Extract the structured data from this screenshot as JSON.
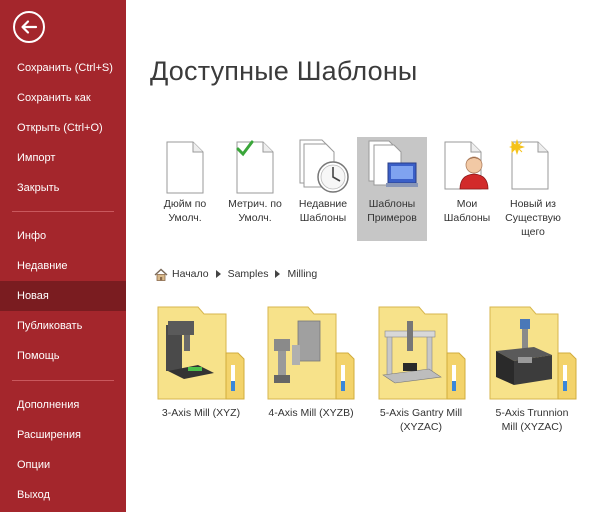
{
  "sidebar": {
    "back_label": "Назад",
    "items": [
      {
        "label": "Сохранить (Ctrl+S)"
      },
      {
        "label": "Сохранить как"
      },
      {
        "label": "Открыть (Ctrl+O)"
      },
      {
        "label": "Импорт"
      },
      {
        "label": "Закрыть"
      },
      {
        "label": "Инфо"
      },
      {
        "label": "Недавние"
      },
      {
        "label": "Новая",
        "active": true
      },
      {
        "label": "Публиковать"
      },
      {
        "label": "Помощь"
      },
      {
        "label": "Дополнения"
      },
      {
        "label": "Расширения"
      },
      {
        "label": "Опции"
      },
      {
        "label": "Выход"
      }
    ],
    "accent": "#a4262c",
    "active_color": "#7a1c20"
  },
  "main": {
    "title": "Доступные Шаблоны",
    "tiles": [
      {
        "line1": "Дюйм по",
        "line2": "Умолч.",
        "line3": "",
        "icon": "blank-document-icon"
      },
      {
        "line1": "Метрич. по",
        "line2": "Умолч.",
        "line3": "",
        "icon": "checked-document-icon"
      },
      {
        "line1": "Недавние",
        "line2": "Шаблоны",
        "line3": "",
        "icon": "clock-documents-icon"
      },
      {
        "line1": "Шаблоны",
        "line2": "Примеров",
        "line3": "",
        "icon": "sample-templates-icon",
        "selected": true
      },
      {
        "line1": "Мои",
        "line2": "Шаблоны",
        "line3": "",
        "icon": "user-document-icon"
      },
      {
        "line1": "Новый из",
        "line2": "Существую",
        "line3": "щего",
        "icon": "new-from-existing-icon"
      }
    ],
    "breadcrumb": [
      "Начало",
      "Samples",
      "Milling"
    ],
    "cards": [
      {
        "line1": "3-Axis Mill (XYZ)",
        "line2": "",
        "icon": "3-axis-mill-icon"
      },
      {
        "line1": "4-Axis Mill (XYZB)",
        "line2": "",
        "icon": "4-axis-mill-icon"
      },
      {
        "line1": "5-Axis Gantry Mill",
        "line2": "(XYZAC)",
        "icon": "5-axis-gantry-mill-icon"
      },
      {
        "line1": "5-Axis Trunnion",
        "line2": "Mill (XYZAC)",
        "icon": "5-axis-trunnion-mill-icon"
      }
    ]
  }
}
